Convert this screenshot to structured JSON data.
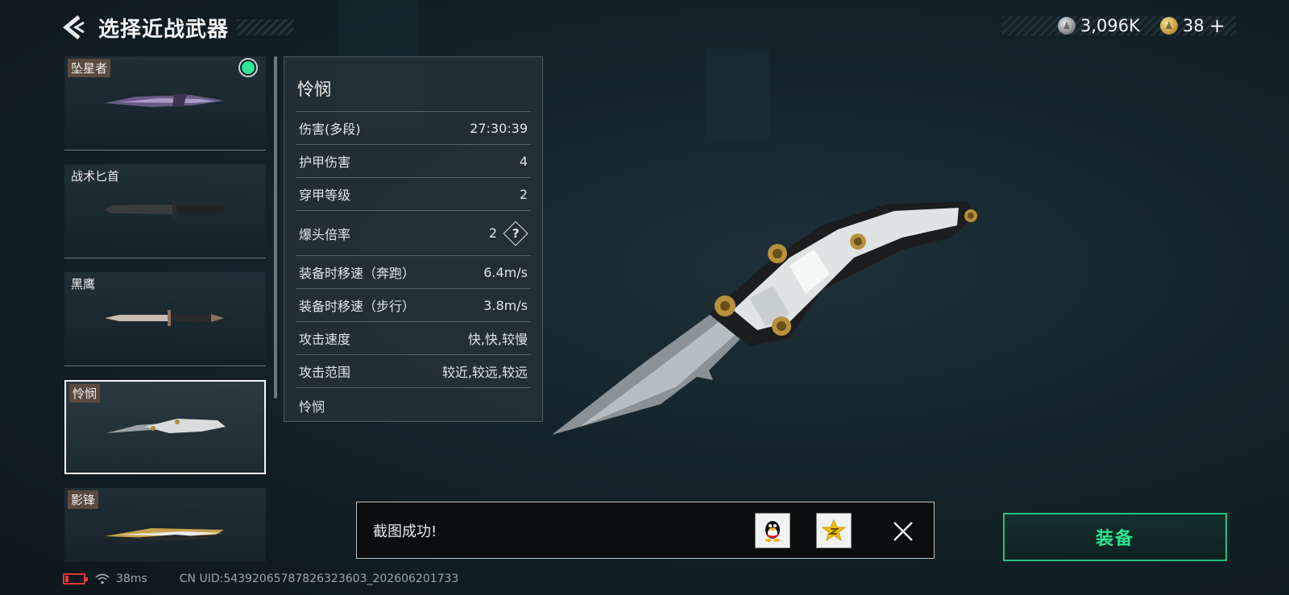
{
  "header": {
    "title": "选择近战武器",
    "currencies": [
      {
        "icon": "silver-coin-icon",
        "value": "3,096K"
      },
      {
        "icon": "gold-coin-icon",
        "value": "38"
      }
    ],
    "plus_label": "+"
  },
  "weapon_list": [
    {
      "label": "坠星者",
      "equipped": true,
      "selected": false
    },
    {
      "label": "战术匕首",
      "equipped": false,
      "selected": false
    },
    {
      "label": "黑鹰",
      "equipped": false,
      "selected": false
    },
    {
      "label": "怜悯",
      "equipped": false,
      "selected": true
    },
    {
      "label": "影锋",
      "equipped": false,
      "selected": false
    }
  ],
  "stats": {
    "weapon_name": "怜悯",
    "rows": [
      {
        "label": "伤害(多段)",
        "value": "27:30:39"
      },
      {
        "label": "护甲伤害",
        "value": "4"
      },
      {
        "label": "穿甲等级",
        "value": "2"
      },
      {
        "label": "爆头倍率",
        "value": "2"
      },
      {
        "label": "装备时移速（奔跑）",
        "value": "6.4m/s"
      },
      {
        "label": "装备时移速（步行）",
        "value": "3.8m/s"
      },
      {
        "label": "攻击速度",
        "value": "快,快,较慢"
      },
      {
        "label": "攻击范围",
        "value": "较近,较远,较远"
      }
    ],
    "help_symbol": "?",
    "footer": "怜悯"
  },
  "toast": {
    "message": "截图成功!",
    "share_icons": [
      "qq-icon",
      "qzone-icon"
    ]
  },
  "equip_button": {
    "label": "装备"
  },
  "status_bar": {
    "ping": "38ms",
    "uid": "CN UID:54392065787826323603_202606201733"
  },
  "colors": {
    "accent_green": "#2be68f",
    "battery_red": "#e23a3a",
    "background": "#14232b"
  }
}
